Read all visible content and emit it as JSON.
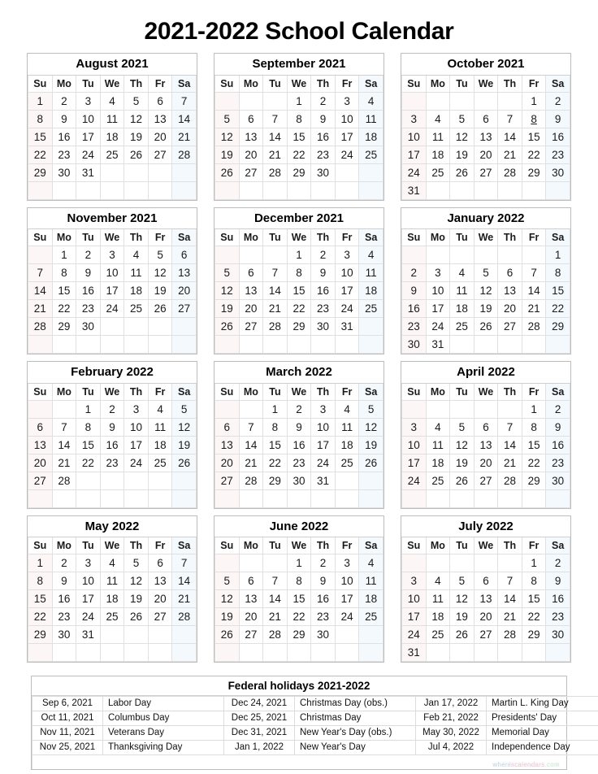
{
  "page": {
    "title": "2021-2022 School Calendar",
    "watermark": {
      "part1": "wheni",
      "part2": "scalendars",
      "part3": ".com"
    }
  },
  "weekday_headers": [
    "Su",
    "Mo",
    "Tu",
    "We",
    "Th",
    "Fr",
    "Sa"
  ],
  "colors": {
    "sunday": "#b01020",
    "saturday": "#1b77c4",
    "holiday": "#c3121f",
    "link_day": "#3b34c8",
    "border": "#bdbdbd"
  },
  "months": [
    {
      "name": "August 2021",
      "first_weekday_index": 0,
      "days_in_month": 31,
      "holidays": [],
      "link_days": []
    },
    {
      "name": "September 2021",
      "first_weekday_index": 3,
      "days_in_month": 30,
      "holidays": [
        6
      ],
      "link_days": []
    },
    {
      "name": "October 2021",
      "first_weekday_index": 5,
      "days_in_month": 31,
      "holidays": [
        11
      ],
      "link_days": [
        8
      ]
    },
    {
      "name": "November 2021",
      "first_weekday_index": 1,
      "days_in_month": 30,
      "holidays": [
        11,
        25
      ],
      "link_days": []
    },
    {
      "name": "December 2021",
      "first_weekday_index": 3,
      "days_in_month": 31,
      "holidays": [
        24,
        31
      ],
      "link_days": []
    },
    {
      "name": "January 2022",
      "first_weekday_index": 6,
      "days_in_month": 31,
      "holidays": [
        17
      ],
      "link_days": []
    },
    {
      "name": "February 2022",
      "first_weekday_index": 2,
      "days_in_month": 28,
      "holidays": [
        21
      ],
      "link_days": []
    },
    {
      "name": "March 2022",
      "first_weekday_index": 2,
      "days_in_month": 31,
      "holidays": [],
      "link_days": []
    },
    {
      "name": "April 2022",
      "first_weekday_index": 5,
      "days_in_month": 30,
      "holidays": [],
      "link_days": []
    },
    {
      "name": "May 2022",
      "first_weekday_index": 0,
      "days_in_month": 31,
      "holidays": [
        30
      ],
      "link_days": []
    },
    {
      "name": "June 2022",
      "first_weekday_index": 3,
      "days_in_month": 30,
      "holidays": [],
      "link_days": []
    },
    {
      "name": "July 2022",
      "first_weekday_index": 5,
      "days_in_month": 31,
      "holidays": [
        4
      ],
      "link_days": []
    }
  ],
  "holidays_table": {
    "title": "Federal holidays 2021-2022",
    "rows": [
      [
        {
          "date": "Sep 6, 2021",
          "name": "Labor Day"
        },
        {
          "date": "Dec 24, 2021",
          "name": "Christmas Day (obs.)"
        },
        {
          "date": "Jan 17, 2022",
          "name": "Martin L. King Day"
        }
      ],
      [
        {
          "date": "Oct 11, 2021",
          "name": "Columbus Day"
        },
        {
          "date": "Dec 25, 2021",
          "name": "Christmas Day"
        },
        {
          "date": "Feb 21, 2022",
          "name": "Presidents' Day"
        }
      ],
      [
        {
          "date": "Nov 11, 2021",
          "name": "Veterans Day"
        },
        {
          "date": "Dec 31, 2021",
          "name": "New Year's Day (obs.)"
        },
        {
          "date": "May 30, 2022",
          "name": "Memorial Day"
        }
      ],
      [
        {
          "date": "Nov 25, 2021",
          "name": "Thanksgiving Day"
        },
        {
          "date": "Jan 1, 2022",
          "name": "New Year's Day"
        },
        {
          "date": "Jul 4, 2022",
          "name": "Independence Day"
        }
      ]
    ]
  }
}
